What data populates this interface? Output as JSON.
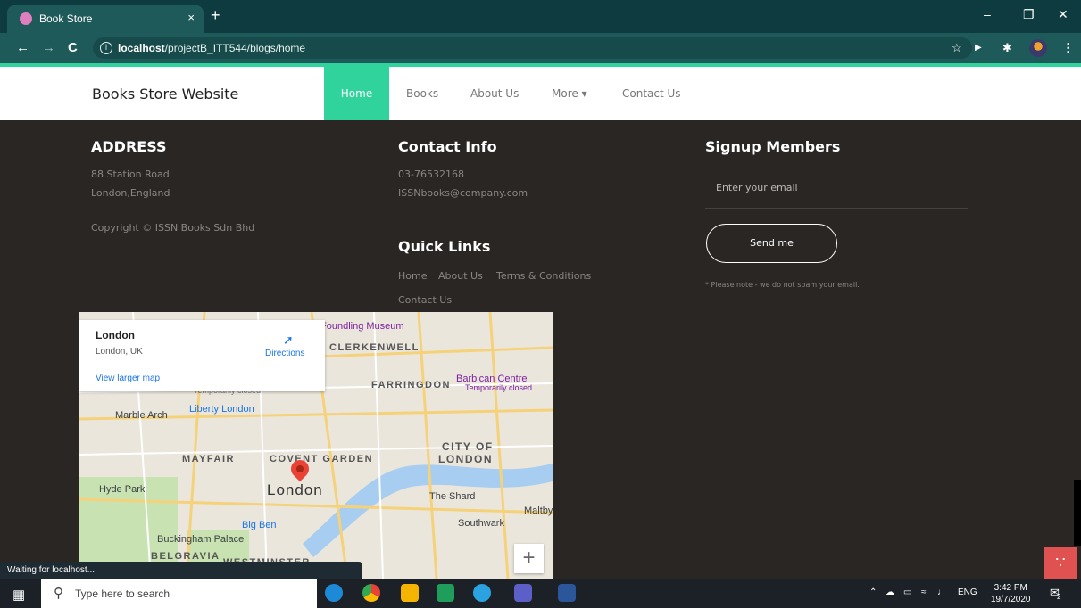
{
  "browser": {
    "tab_title": "Book Store",
    "tab_close": "×",
    "new_tab": "+",
    "url_host": "localhost",
    "url_path": "/projectB_ITT544/blogs/home"
  },
  "navbar": {
    "brand": "Books Store Website",
    "items": [
      {
        "label": "Home",
        "active": true
      },
      {
        "label": "Books"
      },
      {
        "label": "About Us"
      },
      {
        "label": "More ▾"
      },
      {
        "label": "Contact Us"
      }
    ]
  },
  "address": {
    "heading": "ADDRESS",
    "line1": "88 Station Road",
    "line2": "London,England",
    "copyright": "Copyright © ISSN Books Sdn Bhd"
  },
  "contact": {
    "heading": "Contact Info",
    "phone": "03-76532168",
    "email": "ISSNbooks@company.com"
  },
  "quick_links": {
    "heading": "Quick Links",
    "links": [
      "Home",
      "About Us",
      "Terms & Conditions",
      "Contact Us"
    ]
  },
  "signup": {
    "heading": "Signup Members",
    "placeholder": "Enter your email",
    "button": "Send me",
    "note": "* Please note - we do not spam your email."
  },
  "map": {
    "place": "London",
    "place_sub": "London, UK",
    "directions": "Directions",
    "larger_map": "View larger map",
    "zoom_in": "+",
    "labels": {
      "foundling": "Foundling Museum",
      "clerkenwell": "CLERKENWELL",
      "farringdon": "FARRINGDON",
      "barbican": "Barbican Centre",
      "barbican_sub": "Temporarily closed",
      "temp_closed": "Temporarily closed",
      "marble_arch": "Marble Arch",
      "liberty": "Liberty London",
      "mayfair": "MAYFAIR",
      "covent": "COVENT GARDEN",
      "city": "CITY OF",
      "city2": "LONDON",
      "london": "London",
      "hyde": "Hyde Park",
      "shard": "The Shard",
      "southwark": "Southwark",
      "bigben": "Big Ben",
      "buckingham": "Buckingham Palace",
      "belgravia": "BELGRAVIA",
      "westminster": "WESTMINSTER",
      "maltby": "Maltby"
    }
  },
  "status_text": "Waiting for localhost...",
  "taskbar": {
    "search_placeholder": "Type here to search",
    "lang": "ENG",
    "time": "3:42 PM",
    "date": "19/7/2020",
    "notif_count": "2"
  }
}
